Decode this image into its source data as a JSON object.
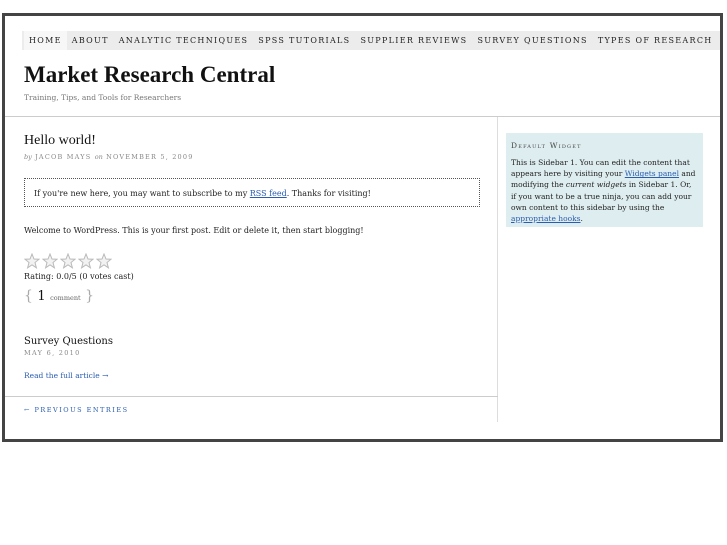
{
  "nav": {
    "items": [
      "HOME",
      "ABOUT",
      "ANALYTIC TECHNIQUES",
      "SPSS TUTORIALS",
      "SUPPLIER REVIEWS",
      "SURVEY QUESTIONS",
      "TYPES OF RESEARCH"
    ]
  },
  "site": {
    "title": "Market Research Central",
    "tagline": "Training, Tips, and Tools for Researchers"
  },
  "post": {
    "title": "Hello world!",
    "by_word": "by",
    "author": "JACOB MAYS",
    "on_word": "on",
    "date": "NOVEMBER 5, 2009",
    "notice_before": "If you're new here, you may want to subscribe to my ",
    "notice_link": "RSS feed",
    "notice_after": ". Thanks for visiting!",
    "body": "Welcome to WordPress. This is your first post. Edit or delete it, then start blogging!",
    "rating_value": 0,
    "rating_max": 5,
    "rating_text": "Rating: 0.0/5 (0 votes cast)",
    "comment_open": "{",
    "comment_count": "1",
    "comment_word": "comment",
    "comment_close": "}"
  },
  "post2": {
    "title": "Survey Questions",
    "date": "MAY 6, 2010",
    "read_more": "Read the full article →"
  },
  "pagination": {
    "prev": "← PREVIOUS ENTRIES"
  },
  "widget": {
    "title": "Default Widget",
    "text1": "This is Sidebar 1. You can edit the content that appears here by visiting your ",
    "link1": "Widgets panel",
    "text2": " and modifying the ",
    "em1": "current widgets",
    "text3": " in Sidebar 1. Or, if you want to be a true ninja, you can add your own content to this sidebar by using the ",
    "link2": "appropriate hooks",
    "text4": "."
  },
  "colors": {
    "link": "#2a5db0",
    "widget_bg": "#deedf0",
    "nav_bg": "#ececec",
    "frame": "#444444"
  }
}
